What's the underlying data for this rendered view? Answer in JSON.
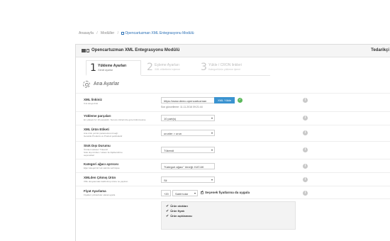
{
  "breadcrumb": {
    "home": "Anasayfa",
    "modules": "Modüller",
    "current": "Opencartuzman XML Entegrasyonu Modülü"
  },
  "panel": {
    "title": "Opencartuzman XML Entegrasyonu Modülü",
    "header_right": "Tedarikçi"
  },
  "steps": [
    {
      "num": "1",
      "title": "Yükleme Ayarları",
      "subtitle": "Genel ayarlar"
    },
    {
      "num": "2",
      "title": "Eşleme Ayarları",
      "subtitle": "XML etiketlerini eşleme"
    },
    {
      "num": "3",
      "title": "Yükle / CRON linkleri",
      "subtitle": "Kategori/ürün yükleme işlemi"
    }
  ],
  "section_title": "Ana Ayarlar",
  "form": {
    "xml_link": {
      "label": "XML linkiniz",
      "hint": "Xml dosya linki",
      "value": "https://www.demo.opencartuzman",
      "button": "XML Yükle",
      "note": "Son güncelleme: 11.11.2016 09:21:44"
    },
    "load_parts": {
      "label": "Yükleme parçaları",
      "hint": "En yüksek hız 10 parçalıdır. Sunucu izinlerinize göre bölünmesine",
      "value": "10 part(s)"
    },
    "product_tag": {
      "label": "XML Ürün Etiketi",
      "hint1": "Ana ürün yerinin parametresi örneği:",
      "hint2": "Genelde Products ve Product şeklindedir",
      "value": "urunler > urun"
    },
    "out_of_stock": {
      "label": "Stok Dışı Durumu",
      "hint1": "Ürünleri stoksuz 'Tükendi'",
      "hint2": "Stok dışı ürünler / sistem ile ilişkilendirme",
      "hint3": "seçenekleri",
      "value": "Tükendi"
    },
    "category_separator": {
      "label": "Kategori ağacı ayırıcısı",
      "hint": "Eğer kategoriniz tek satırda verilmişse",
      "value": "\"Kategori ağacı\" örneği: KAT.AK"
    },
    "removed_product": {
      "label": "XMLden Çıkmış Ürün",
      "hint": "XML dosyasından kaldırılmış ürüne ne yapılsın",
      "value": "Sil"
    },
    "price": {
      "label": "Fiyat Ayarlama",
      "hint": "Fiyatları yüzde/tutar olarak ayarla",
      "value": "+20",
      "mode": "Sabit tutar",
      "option_label": "Seçenek fiyatlarına da uygula"
    },
    "update_items": [
      "Ürün stokları",
      "Ürün fiyatı",
      "Ürün açıklaması"
    ]
  },
  "icons": {
    "info": "i",
    "ok": "✓"
  }
}
